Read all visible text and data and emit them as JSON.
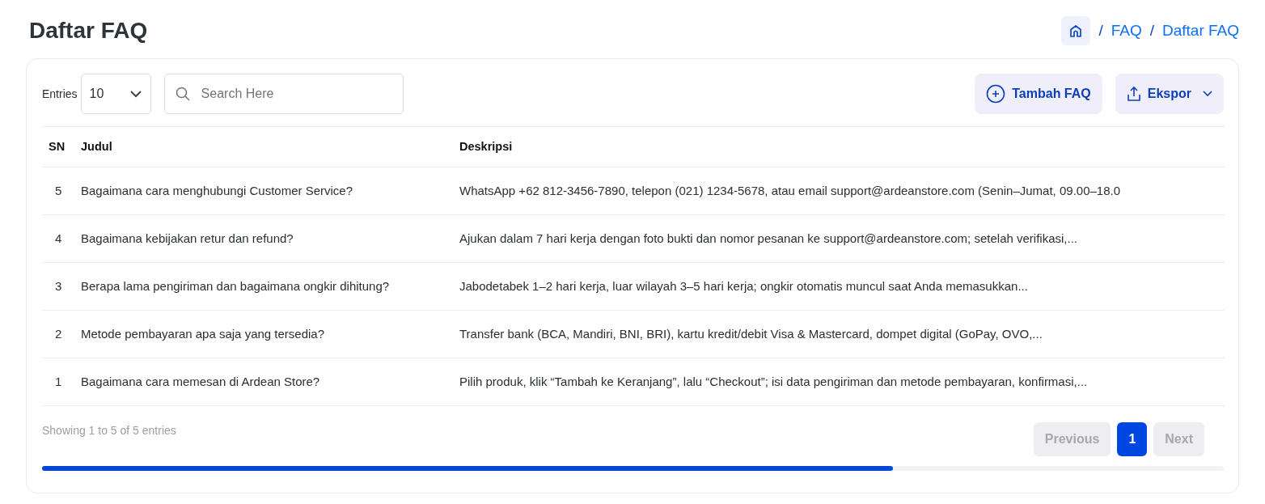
{
  "page_title": "Daftar FAQ",
  "breadcrumb": [
    {
      "separator": "/",
      "label": "FAQ"
    },
    {
      "separator": "/",
      "label": "Daftar FAQ"
    }
  ],
  "entries": {
    "label": "Entries",
    "value": "10"
  },
  "search": {
    "placeholder": "Search Here"
  },
  "actions": [
    {
      "kind": "add",
      "label": "Tambah FAQ"
    },
    {
      "kind": "export",
      "label": "Ekspor"
    }
  ],
  "table": {
    "columns": [
      "SN",
      "Judul",
      "Deskripsi"
    ],
    "rows": [
      {
        "sn": "5",
        "title": "Bagaimana cara menghubungi Customer Service?",
        "description": "WhatsApp +62 812-3456-7890, telepon (021) 1234-5678, atau email support@ardeanstore.com (Senin–Jumat, 09.00–18.0"
      },
      {
        "sn": "4",
        "title": "Bagaimana kebijakan retur dan refund?",
        "description": "Ajukan dalam 7 hari kerja dengan foto bukti dan nomor pesanan ke support@ardeanstore.com; setelah verifikasi,..."
      },
      {
        "sn": "3",
        "title": "Berapa lama pengiriman dan bagaimana ongkir dihitung?",
        "description": "Jabodetabek 1–2 hari kerja, luar wilayah 3–5 hari kerja; ongkir otomatis muncul saat Anda memasukkan..."
      },
      {
        "sn": "2",
        "title": "Metode pembayaran apa saja yang tersedia?",
        "description": "Transfer bank (BCA, Mandiri, BNI, BRI), kartu kredit/debit Visa & Mastercard, dompet digital (GoPay, OVO,..."
      },
      {
        "sn": "1",
        "title": "Bagaimana cara memesan di Ardean Store?",
        "description": "Pilih produk, klik “Tambah ke Keranjang”, lalu “Checkout”; isi data pengiriman dan metode pembayaran, konfirmasi,..."
      }
    ]
  },
  "footer": {
    "summary": "Showing 1 to 5 of 5 entries"
  },
  "pagination": [
    {
      "label": "Previous",
      "disabled": true,
      "selected": false
    },
    {
      "label": "1",
      "disabled": false,
      "selected": true
    },
    {
      "label": "Next",
      "disabled": true,
      "selected": false
    }
  ]
}
